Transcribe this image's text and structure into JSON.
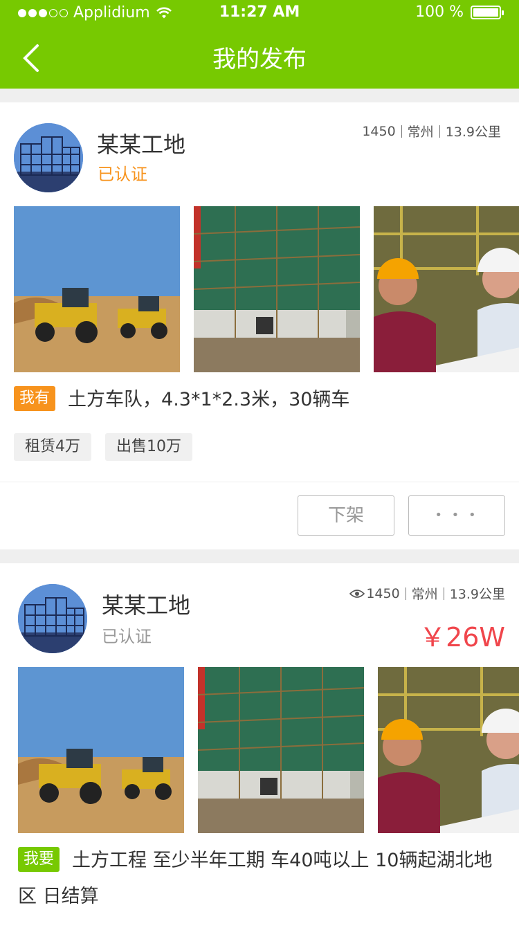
{
  "status_bar": {
    "carrier": "Applidium",
    "time": "11:27 AM",
    "battery": "100 %",
    "battery_level": 1.0
  },
  "nav": {
    "title": "我的发布",
    "back_icon": "chevron-left-icon"
  },
  "colors": {
    "brand": "#77c901",
    "want_badge": "#77c901",
    "have_badge": "#f7931d",
    "verified_orange": "#f7931d",
    "price_red": "#f0464c"
  },
  "posts": [
    {
      "site_name": "某某工地",
      "verified": "已认证",
      "views": "1450",
      "city": "常州",
      "distance": "13.9公里",
      "badge": "我有",
      "title": "土方车队，4.3*1*2.3米，30辆车",
      "tags": [
        "租赁4万",
        "出售10万"
      ],
      "buttons": {
        "takedown": "下架",
        "more": "• • •"
      }
    },
    {
      "site_name": "某某工地",
      "verified": "已认证",
      "views": "1450",
      "city": "常州",
      "distance": "13.9公里",
      "price": "￥26W",
      "badge": "我要",
      "title": "土方工程 至少半年工期 车40吨以上 10辆起湖北地区 日结算"
    }
  ]
}
